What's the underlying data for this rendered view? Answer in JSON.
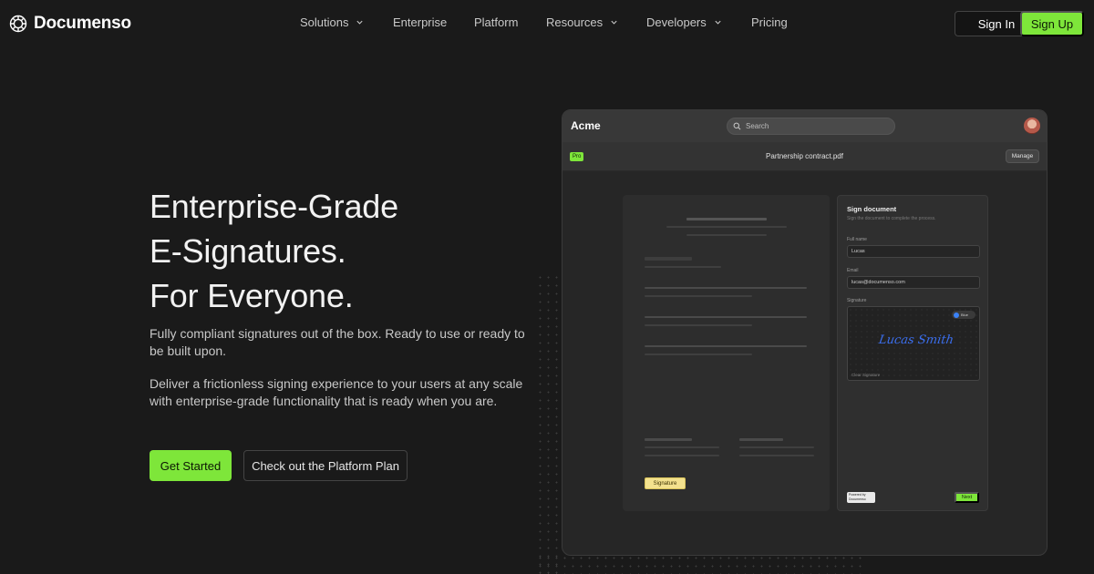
{
  "brand": {
    "name": "Documenso"
  },
  "nav": {
    "items": [
      {
        "label": "Solutions",
        "dropdown": true
      },
      {
        "label": "Enterprise",
        "dropdown": false
      },
      {
        "label": "Platform",
        "dropdown": false
      },
      {
        "label": "Resources",
        "dropdown": true
      },
      {
        "label": "Developers",
        "dropdown": true
      },
      {
        "label": "Pricing",
        "dropdown": false
      }
    ],
    "sign_in": "Sign In",
    "sign_up": "Sign Up"
  },
  "hero": {
    "title_lines": [
      "Enterprise-Grade",
      "E-Signatures.",
      "For Everyone."
    ],
    "paragraph_1": "Fully compliant signatures out of the box. Ready to use or ready to be built upon.",
    "paragraph_2": "Deliver a frictionless signing experience to your users at any scale with enterprise-grade functionality that is ready when you are.",
    "cta_primary": "Get Started",
    "cta_secondary": "Check out the Platform Plan"
  },
  "mockup": {
    "app_name": "Acme",
    "search_placeholder": "Search",
    "plan_badge": "Pro",
    "document_title": "Partnership contract.pdf",
    "manage_label": "Manage",
    "signature_field_label": "Signature",
    "sign_panel": {
      "title": "Sign document",
      "subtitle": "Sign the document to complete the process.",
      "full_name_label": "Full name",
      "full_name_value": "Lucas",
      "email_label": "Email",
      "email_value": "lucas@documenso.com",
      "signature_label": "Signature",
      "color_label": "Blue",
      "signature_script": "Lucas Smith",
      "clear_label": "Clear Signature",
      "powered_by": "Powered by Documenso",
      "next_label": "Next"
    }
  },
  "colors": {
    "background": "#1a1a1a",
    "accent": "#7ee63a",
    "signature_ink": "#3b6ff0",
    "signature_field": "#f3e18e"
  }
}
